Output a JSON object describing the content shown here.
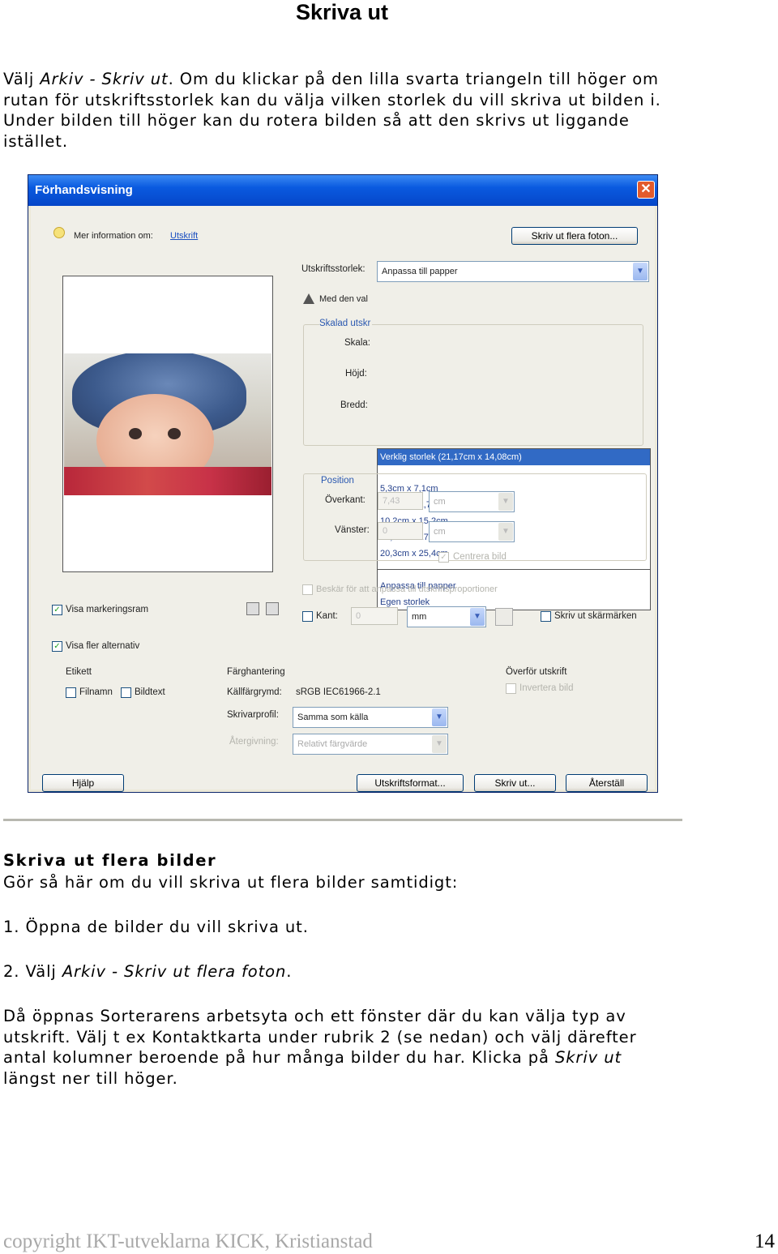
{
  "page": {
    "title": "Skriva ut",
    "intro": {
      "l1a": "Välj ",
      "l1b": "Arkiv - Skriv ut",
      "l1c": ". Om du klickar på den lilla svarta triangeln till höger om",
      "l2": "rutan för utskriftsstorlek kan du välja vilken storlek du vill skriva ut bilden i.",
      "l3": "Under bilden till höger kan du rotera bilden så att den skrivs ut liggande",
      "l4": "istället."
    },
    "section2_title": "Skriva ut flera bilder",
    "section2_lead": "Gör så här om du vill skriva ut flera bilder samtidigt:",
    "step1": "1. Öppna de bilder du vill skriva ut.",
    "step2": {
      "a": "2. Välj ",
      "b": "Arkiv - Skriv ut flera foton",
      "c": "."
    },
    "closing": {
      "l1": "Då öppnas Sorterarens arbetsyta och ett fönster där du kan välja typ av",
      "l2": "utskrift. Välj t ex Kontaktkarta under rubrik 2 (se nedan) och välj därefter",
      "l3a": "antal kolumner beroende på hur många bilder du har. Klicka på ",
      "l3b": "Skriv ut",
      "l4": "längst ner till höger."
    },
    "footer": "copyright IKT-utveklarna KICK, Kristianstad",
    "page_number": "14"
  },
  "dialog": {
    "title": "Förhandsvisning",
    "close_glyph": "✕",
    "info_prefix": "Mer information om:",
    "info_link": "Utskrift",
    "multi_button": "Skriv ut flera foton...",
    "size_label": "Utskriftsstorlek:",
    "size_value": "Anpassa till papper",
    "warn_label": "Med den val",
    "scaled_label": "Skalad utskr",
    "scale_label": "Skala:",
    "height_label": "Höjd:",
    "width_label": "Bredd:",
    "size_options": [
      "Verklig storlek (21,17cm x 14,08cm)",
      "5,3cm x 7,1cm",
      "8,9cm x 12,7cm",
      "10,2cm x 15,2cm",
      "12,7cm x 17,8cm",
      "20,3cm x 25,4cm",
      "Anpassa till papper",
      "Egen storlek"
    ],
    "position_label": "Position",
    "top_label": "Överkant:",
    "top_value": "7,43",
    "left_label": "Vänster:",
    "left_value": "0",
    "unit_cm": "cm",
    "center_label": "Centrera bild",
    "crop_label": "Beskär för att anpassa till utskriftsproportioner",
    "border_label": "Kant:",
    "border_value": "0",
    "unit_mm": "mm",
    "crop_marks_label": "Skriv ut skärmärken",
    "show_frame_label": "Visa markeringsram",
    "more_options_label": "Visa fler alternativ",
    "label_group": "Etikett",
    "filename_label": "Filnamn",
    "caption_label": "Bildtext",
    "color_group": "Färghantering",
    "source_space_label": "Källfärgrymd:",
    "source_space_value": "sRGB IEC61966-2.1",
    "printer_profile_label": "Skrivarprofil:",
    "printer_profile_value": "Samma som källa",
    "rendering_label": "Återgivning:",
    "rendering_value": "Relativt färgvärde",
    "transfer_group": "Överför utskrift",
    "invert_label": "Invertera bild",
    "help_button": "Hjälp",
    "page_setup_button": "Utskriftsformat...",
    "print_button": "Skriv ut...",
    "reset_button": "Återställ",
    "arrow_glyph": "▼",
    "check_glyph": "✓"
  }
}
